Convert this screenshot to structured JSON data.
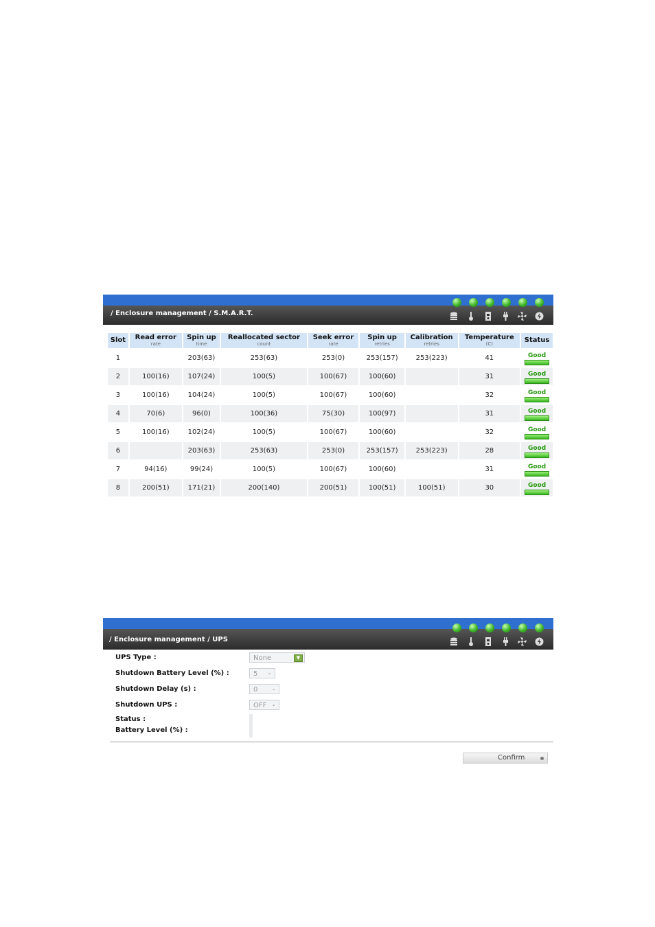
{
  "smart_panel": {
    "title": "/ Enclosure management / S.M.A.R.T.",
    "indicator_icons": [
      "disk-icon",
      "thermometer-icon",
      "power-supply-icon",
      "ups-plug-icon",
      "fan-icon",
      "voltage-icon"
    ],
    "led_color": "#3fb52a",
    "header_color": "#2f6fd0",
    "columns": [
      {
        "label": "Slot",
        "sub": ""
      },
      {
        "label": "Read error",
        "sub": "rate"
      },
      {
        "label": "Spin up",
        "sub": "time"
      },
      {
        "label": "Reallocated sector",
        "sub": "count"
      },
      {
        "label": "Seek error",
        "sub": "rate"
      },
      {
        "label": "Spin up",
        "sub": "retries"
      },
      {
        "label": "Calibration",
        "sub": "retries"
      },
      {
        "label": "Temperature",
        "sub": "(C)"
      },
      {
        "label": "Status",
        "sub": ""
      }
    ],
    "rows": [
      [
        "1",
        "",
        "203(63)",
        "253(63)",
        "253(0)",
        "253(157)",
        "253(223)",
        "41",
        "Good"
      ],
      [
        "2",
        "100(16)",
        "107(24)",
        "100(5)",
        "100(67)",
        "100(60)",
        "",
        "31",
        "Good"
      ],
      [
        "3",
        "100(16)",
        "104(24)",
        "100(5)",
        "100(67)",
        "100(60)",
        "",
        "32",
        "Good"
      ],
      [
        "4",
        "70(6)",
        "96(0)",
        "100(36)",
        "75(30)",
        "100(97)",
        "",
        "31",
        "Good"
      ],
      [
        "5",
        "100(16)",
        "102(24)",
        "100(5)",
        "100(67)",
        "100(60)",
        "",
        "32",
        "Good"
      ],
      [
        "6",
        "",
        "203(63)",
        "253(63)",
        "253(0)",
        "253(157)",
        "253(223)",
        "28",
        "Good"
      ],
      [
        "7",
        "94(16)",
        "99(24)",
        "100(5)",
        "100(67)",
        "100(60)",
        "",
        "31",
        "Good"
      ],
      [
        "8",
        "200(51)",
        "171(21)",
        "200(140)",
        "200(51)",
        "100(51)",
        "100(51)",
        "30",
        "Good"
      ]
    ]
  },
  "ups_panel": {
    "title": "/ Enclosure management / UPS",
    "fields": {
      "ups_type_label": "UPS Type :",
      "ups_type_value": "None",
      "battery_level_label": "Shutdown Battery Level (%) :",
      "battery_level_value": "5",
      "delay_label": "Shutdown Delay (s) :",
      "delay_value": "0",
      "shutdown_ups_label": "Shutdown UPS :",
      "shutdown_ups_value": "OFF",
      "status_label": "Status :",
      "battery_pct_label": "Battery Level (%) :"
    },
    "confirm_label": "Confirm"
  }
}
